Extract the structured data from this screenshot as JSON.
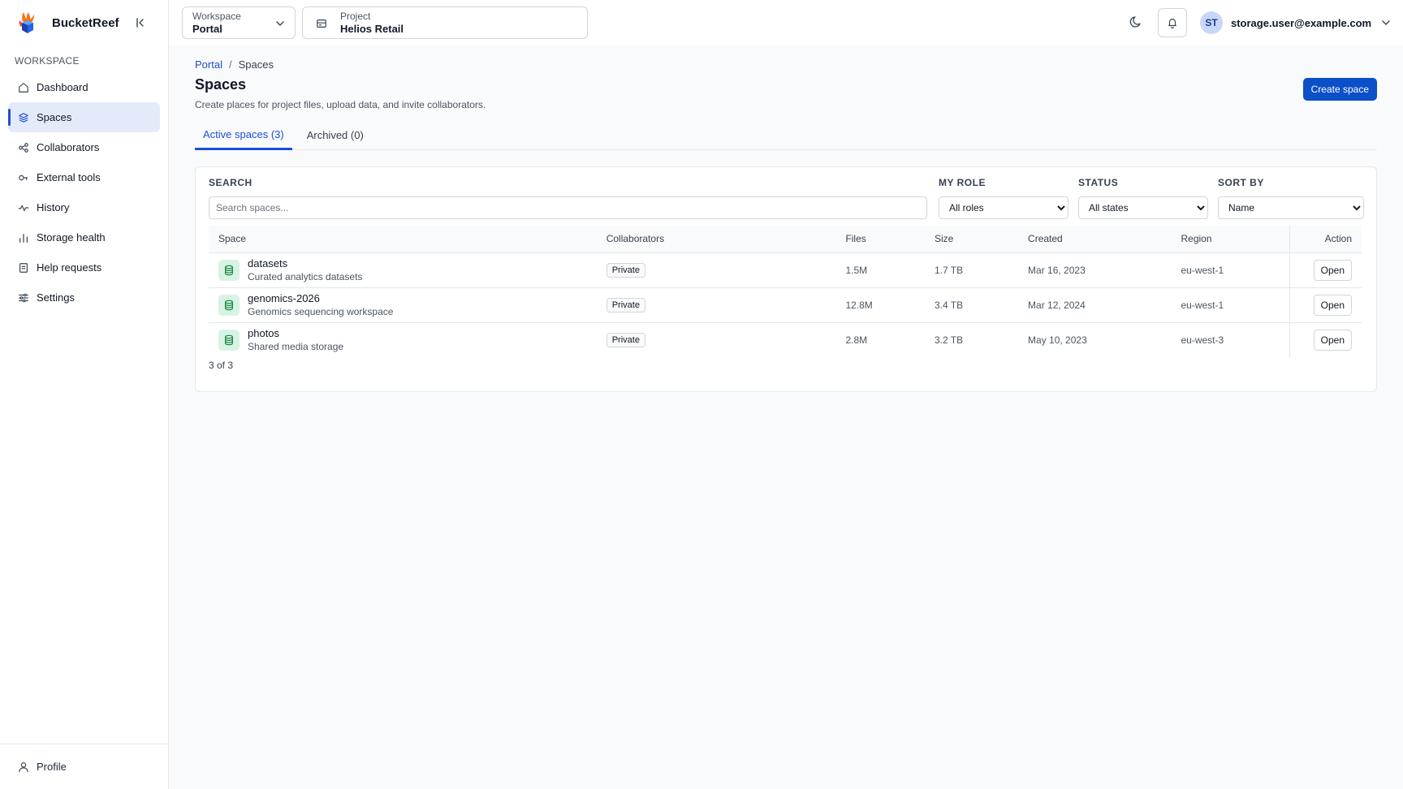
{
  "brand": {
    "name": "BucketReef"
  },
  "sidebar": {
    "section_label": "WORKSPACE",
    "items": [
      {
        "label": "Dashboard",
        "icon": "home-icon"
      },
      {
        "label": "Spaces",
        "icon": "layers-icon",
        "active": true
      },
      {
        "label": "Collaborators",
        "icon": "share-icon"
      },
      {
        "label": "External tools",
        "icon": "key-icon"
      },
      {
        "label": "History",
        "icon": "activity-icon"
      },
      {
        "label": "Storage health",
        "icon": "bar-chart-icon"
      },
      {
        "label": "Help requests",
        "icon": "document-icon"
      },
      {
        "label": "Settings",
        "icon": "sliders-icon"
      }
    ],
    "footer": {
      "label": "Profile",
      "icon": "user-icon"
    }
  },
  "topbar": {
    "workspace": {
      "label": "Workspace",
      "value": "Portal"
    },
    "project": {
      "label": "Project",
      "value": "Helios Retail"
    },
    "user": {
      "initials": "ST",
      "email": "storage.user@example.com"
    }
  },
  "page": {
    "breadcrumb": {
      "root": "Portal",
      "current": "Spaces"
    },
    "title": "Spaces",
    "subtitle": "Create places for project files, upload data, and invite collaborators.",
    "create_label": "Create space",
    "tabs": [
      {
        "label": "Active spaces (3)",
        "active": true
      },
      {
        "label": "Archived (0)"
      }
    ]
  },
  "filters": {
    "search": {
      "label": "SEARCH",
      "placeholder": "Search spaces..."
    },
    "role": {
      "label": "MY ROLE",
      "value": "All roles"
    },
    "status": {
      "label": "STATUS",
      "value": "All states"
    },
    "sort": {
      "label": "SORT BY",
      "value": "Name"
    }
  },
  "table": {
    "headers": {
      "space": "Space",
      "collaborators": "Collaborators",
      "files": "Files",
      "size": "Size",
      "created": "Created",
      "region": "Region",
      "action": "Action"
    },
    "rows": [
      {
        "name": "datasets",
        "desc": "Curated analytics datasets",
        "collab": "Private",
        "files": "1.5M",
        "size": "1.7 TB",
        "created": "Mar 16, 2023",
        "region": "eu-west-1",
        "action": "Open"
      },
      {
        "name": "genomics-2026",
        "desc": "Genomics sequencing workspace",
        "collab": "Private",
        "files": "12.8M",
        "size": "3.4 TB",
        "created": "Mar 12, 2024",
        "region": "eu-west-1",
        "action": "Open"
      },
      {
        "name": "photos",
        "desc": "Shared media storage",
        "collab": "Private",
        "files": "2.8M",
        "size": "3.2 TB",
        "created": "May 10, 2023",
        "region": "eu-west-3",
        "action": "Open"
      }
    ],
    "count": "3 of 3"
  },
  "colors": {
    "accent": "#1d4ed8",
    "primary_button": "#0b4fc9",
    "active_nav_bg": "#e3ebfb",
    "space_icon_bg": "#d7f3e4",
    "space_icon_fg": "#15803d"
  }
}
